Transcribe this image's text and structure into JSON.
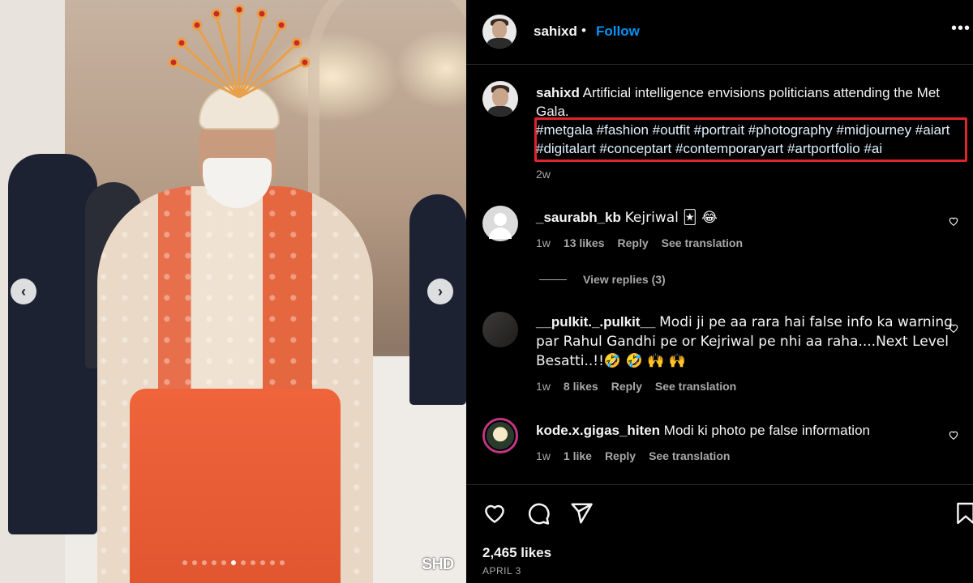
{
  "header": {
    "username": "sahixd",
    "separator": "•",
    "follow_label": "Follow",
    "more_label": "•••"
  },
  "caption": {
    "username": "sahixd",
    "text": "Artificial intelligence envisions politicians attending the Met Gala.",
    "hashtags": "#metgala #fashion #outfit #portrait #photography #midjourney #aiart #digitalart #conceptart #contemporaryart #artportfolio #ai",
    "time": "2w"
  },
  "comments": [
    {
      "username": "_saurabh_kb",
      "text": "Kejriwal 🃏 😂",
      "time": "1w",
      "likes": "13 likes",
      "reply": "Reply",
      "translate": "See translation"
    },
    {
      "username": "__pulkit._.pulkit__",
      "text": "Modi ji pe aa rara hai false info ka warning par Rahul Gandhi pe or Kejriwal pe nhi aa raha....Next Level Besatti..!!🤣 🤣 🙌 🙌",
      "time": "1w",
      "likes": "8 likes",
      "reply": "Reply",
      "translate": "See translation"
    },
    {
      "username": "kode.x.gigas_hiten",
      "text": "Modi ki photo pe false information",
      "time": "1w",
      "likes": "1 like",
      "reply": "Reply",
      "translate": "See translation"
    }
  ],
  "view_replies": "View replies (3)",
  "footer": {
    "likes": "2,465 likes",
    "date": "APRIL 3"
  },
  "media": {
    "watermark": "SHD",
    "carousel_total": 11,
    "carousel_active": 5
  },
  "colors": {
    "accent": "#0095f6",
    "highlight_box": "#e0242c",
    "background": "#000000",
    "muted_text": "#a8a8a8"
  },
  "icons": [
    "chevron-left-icon",
    "chevron-right-icon",
    "more-icon",
    "heart-icon",
    "comment-icon",
    "share-icon",
    "save-icon"
  ]
}
